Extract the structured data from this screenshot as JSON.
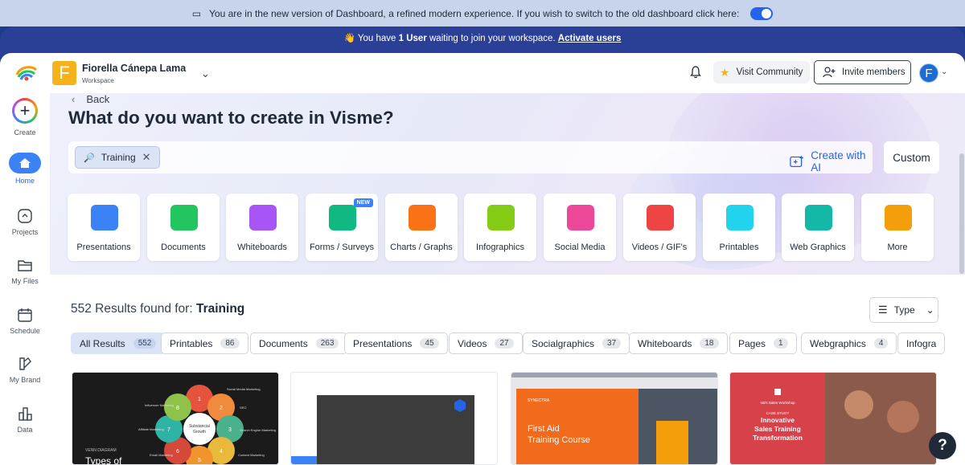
{
  "banner": {
    "text": "You are in the new version of Dashboard, a refined modern experience. If you wish to switch to the old dashboard click here:",
    "toggle_on": true
  },
  "notice": {
    "prefix": "You have ",
    "count": "1 User",
    "suffix": " waiting to join your workspace. ",
    "link": "Activate users"
  },
  "header": {
    "workspace_initial": "F",
    "workspace_name": "Fiorella Cánepa Lama",
    "workspace_label": "Workspace",
    "visit_community": "Visit Community",
    "invite_members": "Invite members",
    "avatar_initial": "F"
  },
  "sidebar": {
    "items": [
      {
        "label": "Create"
      },
      {
        "label": "Home"
      },
      {
        "label": "Projects"
      },
      {
        "label": "My Files"
      },
      {
        "label": "Schedule"
      },
      {
        "label": "My Brand"
      },
      {
        "label": "Data"
      }
    ]
  },
  "hero": {
    "back": "Back",
    "title": "What do you want to create in Visme?",
    "search_chip": "Training",
    "create_ai": "Create with AI",
    "custom": "Custom"
  },
  "categories": [
    {
      "label": "Presentations",
      "color": "#3b82f6"
    },
    {
      "label": "Documents",
      "color": "#22c55e"
    },
    {
      "label": "Whiteboards",
      "color": "#a855f7"
    },
    {
      "label": "Forms / Surveys",
      "color": "#10b981",
      "badge": "NEW"
    },
    {
      "label": "Charts / Graphs",
      "color": "#f97316"
    },
    {
      "label": "Infographics",
      "color": "#84cc16"
    },
    {
      "label": "Social Media",
      "color": "#ec4899"
    },
    {
      "label": "Videos / GIF's",
      "color": "#ef4444"
    },
    {
      "label": "Printables",
      "color": "#22d3ee"
    },
    {
      "label": "Web Graphics",
      "color": "#14b8a6"
    },
    {
      "label": "More",
      "color": "#f59e0b"
    }
  ],
  "results": {
    "prefix": "552 Results found for: ",
    "query": "Training",
    "type_label": "Type"
  },
  "filters": [
    {
      "label": "All Results",
      "count": "552"
    },
    {
      "label": "Printables",
      "count": "86"
    },
    {
      "label": "Documents",
      "count": "263"
    },
    {
      "label": "Presentations",
      "count": "45"
    },
    {
      "label": "Videos",
      "count": "27"
    },
    {
      "label": "Socialgraphics",
      "count": "37"
    },
    {
      "label": "Whiteboards",
      "count": "18"
    },
    {
      "label": "Pages",
      "count": "1"
    },
    {
      "label": "Webgraphics",
      "count": "4"
    },
    {
      "label": "Infogra",
      "count": ""
    }
  ],
  "cards": {
    "c1": {
      "caption": "VENN DIAGRAM",
      "title": "Types of",
      "center": "Substancial Growth",
      "petals": [
        "1",
        "2",
        "3",
        "4",
        "5",
        "6",
        "7",
        "8"
      ],
      "labels": [
        "Social Media Marketing",
        "SEO",
        "Search Engine Marketing",
        "Content Marketing",
        "Email Marketing",
        "Affiliate Marketing",
        "Influencer Marketing"
      ]
    },
    "c3": {
      "brand": "SYNECTRA",
      "title": "First Aid Training Course"
    },
    "c4": {
      "workshop": "Val's Sales Workshop",
      "kicker": "CASE STUDY",
      "title": "Innovative Sales Training Transformation"
    }
  },
  "help": "?"
}
